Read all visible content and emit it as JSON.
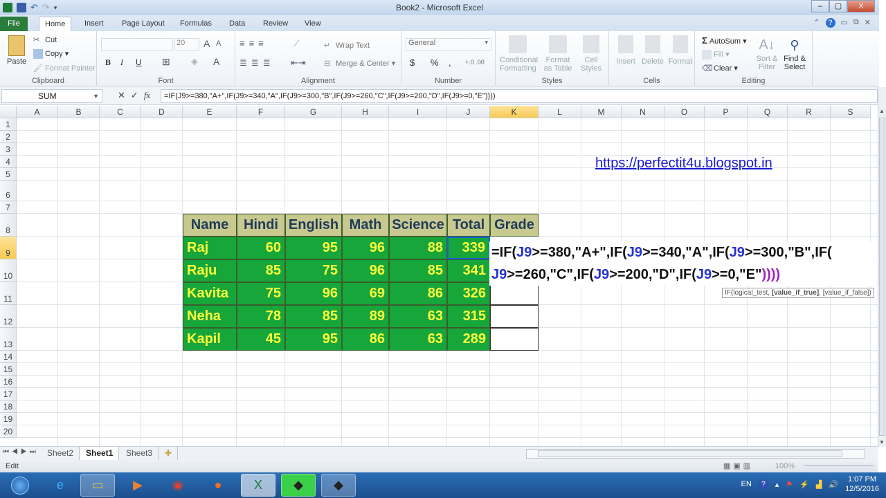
{
  "window": {
    "title": "Book2 - Microsoft Excel",
    "controls": {
      "minimize": "–",
      "maximize": "▢",
      "close": "X"
    }
  },
  "ribbon_tabs": [
    "File",
    "Home",
    "Insert",
    "Page Layout",
    "Formulas",
    "Data",
    "Review",
    "View"
  ],
  "ribbon": {
    "clipboard": {
      "paste": "Paste",
      "cut": "Cut",
      "copy": "Copy",
      "format_painter": "Format Painter",
      "label": "Clipboard"
    },
    "font": {
      "font_name": "",
      "font_size": "20",
      "bold": "B",
      "italic": "I",
      "underline": "U",
      "label": "Font"
    },
    "alignment": {
      "wrap_text": "Wrap Text",
      "merge_center": "Merge & Center",
      "label": "Alignment"
    },
    "number": {
      "format": "General",
      "currency": "$",
      "percent": "%",
      "comma": ",",
      "label": "Number"
    },
    "styles": {
      "conditional": "Conditional Formatting",
      "format_table": "Format as Table",
      "cell_styles": "Cell Styles",
      "label": "Styles"
    },
    "cells": {
      "insert": "Insert",
      "delete": "Delete",
      "format": "Format",
      "label": "Cells"
    },
    "editing": {
      "autosum": "AutoSum",
      "fill": "Fill",
      "clear": "Clear",
      "sort_filter": "Sort & Filter",
      "find_select": "Find & Select",
      "label": "Editing"
    }
  },
  "formula_bar": {
    "name_box": "SUM",
    "cancel": "✕",
    "enter": "✓",
    "fx": "fx",
    "formula": "=IF(J9>=380,\"A+\",IF(J9>=340,\"A\",IF(J9>=300,\"B\",IF(J9>=260,\"C\",IF(J9>=200,\"D\",IF(J9>=0,\"E\"))))"
  },
  "columns": [
    "A",
    "B",
    "C",
    "D",
    "E",
    "F",
    "G",
    "H",
    "I",
    "J",
    "K",
    "L",
    "M",
    "N",
    "O",
    "P",
    "Q",
    "R",
    "S"
  ],
  "selected_column": "K",
  "rows": [
    "1",
    "2",
    "3",
    "4",
    "5",
    "6",
    "7",
    "8",
    "9",
    "10",
    "11",
    "12",
    "13",
    "14",
    "15",
    "16",
    "17",
    "18",
    "19",
    "20"
  ],
  "selected_row": "9",
  "table": {
    "headers": [
      "Name",
      "Hindi",
      "English",
      "Math",
      "Science",
      "Total",
      "Grade"
    ],
    "rows": [
      [
        "Raj",
        "60",
        "95",
        "96",
        "88",
        "339"
      ],
      [
        "Raju",
        "85",
        "75",
        "96",
        "85",
        "341"
      ],
      [
        "Kavita",
        "75",
        "96",
        "69",
        "86",
        "326"
      ],
      [
        "Neha",
        "78",
        "85",
        "89",
        "63",
        "315"
      ],
      [
        "Kapil",
        "45",
        "95",
        "86",
        "63",
        "289"
      ]
    ]
  },
  "in_cell_edit": {
    "line1": [
      "=IF(",
      "J9",
      ">=380,\"A+\",IF(",
      "J9",
      ">=340,\"A\",IF(",
      "J9",
      ">=300,\"B\",IF("
    ],
    "line2": [
      "J9",
      ">=260,\"C\",IF(",
      "J9",
      ">=200,\"D\",IF(",
      "J9",
      ">=0,\"E\"",
      "))))"
    ]
  },
  "tooltip": {
    "func": "IF(logical_test, ",
    "bold": "[value_if_true]",
    "rest": ", [value_if_false])"
  },
  "hyperlink": "https://perfectit4u.blogspot.in",
  "sheets": [
    "Sheet2",
    "Sheet1",
    "Sheet3"
  ],
  "active_sheet": "Sheet1",
  "status": {
    "mode": "Edit",
    "zoom": "100%"
  },
  "taskbar": {
    "apps": [
      "start",
      "internet-explorer",
      "file-explorer",
      "media-player",
      "chrome",
      "firefox",
      "excel",
      "excel-recorder",
      "excel-alt"
    ],
    "language": "EN",
    "time": "1:07 PM",
    "date": "12/5/2016"
  }
}
